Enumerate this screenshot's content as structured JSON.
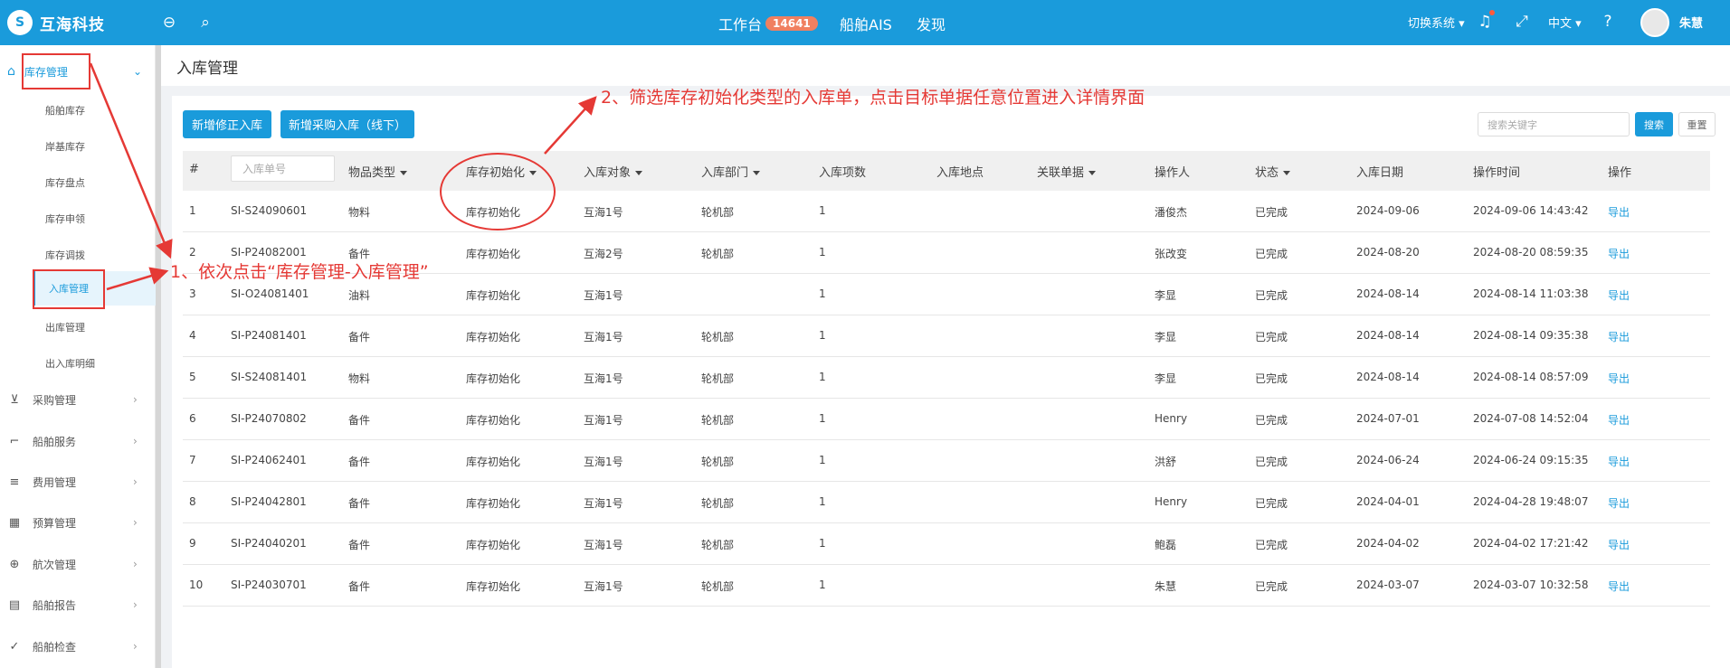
{
  "header": {
    "brand": "互海科技",
    "workbench_label": "工作台",
    "workbench_badge": "14641",
    "ais_label": "船舶AIS",
    "discover_label": "发现",
    "switch_system_label": "切换系统",
    "language_label": "中文",
    "user_name": "朱慧"
  },
  "sidebar": {
    "top_menu_label": "库存管理",
    "sub_items": [
      "船舶库存",
      "岸基库存",
      "库存盘点",
      "库存申领",
      "库存调拨",
      "入库管理",
      "出库管理",
      "出入库明细"
    ],
    "groups": [
      {
        "label": "采购管理",
        "icon": "cart-icon"
      },
      {
        "label": "船舶服务",
        "icon": "paint-roller-icon"
      },
      {
        "label": "费用管理",
        "icon": "database-icon"
      },
      {
        "label": "预算管理",
        "icon": "calculator-icon"
      },
      {
        "label": "航次管理",
        "icon": "globe-icon"
      },
      {
        "label": "船舶报告",
        "icon": "calendar-icon"
      },
      {
        "label": "船舶检查",
        "icon": "check-circle-icon"
      }
    ]
  },
  "page": {
    "title": "入库管理",
    "btn_add_correction": "新增修正入库",
    "btn_add_purchase": "新增采购入库（线下）",
    "search_placeholder": "搜索关键字",
    "btn_search": "搜索",
    "btn_reset": "重置"
  },
  "table": {
    "headers": {
      "index": "#",
      "order_placeholder": "入库单号",
      "item_type": "物品类型",
      "init": "库存初始化",
      "target": "入库对象",
      "dept": "入库部门",
      "count": "入库项数",
      "location": "入库地点",
      "related": "关联单据",
      "operator": "操作人",
      "status": "状态",
      "date": "入库日期",
      "op_time": "操作时间",
      "action": "操作"
    },
    "rows": [
      {
        "idx": "1",
        "no": "SI-S24090601",
        "type": "物料",
        "init": "库存初始化",
        "target": "互海1号",
        "dept": "轮机部",
        "count": "1",
        "operator": "潘俊杰",
        "status": "已完成",
        "date": "2024-09-06",
        "time": "2024-09-06 14:43:42",
        "action": "导出"
      },
      {
        "idx": "2",
        "no": "SI-P24082001",
        "type": "备件",
        "init": "库存初始化",
        "target": "互海2号",
        "dept": "轮机部",
        "count": "1",
        "operator": "张改变",
        "status": "已完成",
        "date": "2024-08-20",
        "time": "2024-08-20 08:59:35",
        "action": "导出"
      },
      {
        "idx": "3",
        "no": "SI-O24081401",
        "type": "油料",
        "init": "库存初始化",
        "target": "互海1号",
        "dept": "",
        "count": "1",
        "operator": "李显",
        "status": "已完成",
        "date": "2024-08-14",
        "time": "2024-08-14 11:03:38",
        "action": "导出"
      },
      {
        "idx": "4",
        "no": "SI-P24081401",
        "type": "备件",
        "init": "库存初始化",
        "target": "互海1号",
        "dept": "轮机部",
        "count": "1",
        "operator": "李显",
        "status": "已完成",
        "date": "2024-08-14",
        "time": "2024-08-14 09:35:38",
        "action": "导出"
      },
      {
        "idx": "5",
        "no": "SI-S24081401",
        "type": "物料",
        "init": "库存初始化",
        "target": "互海1号",
        "dept": "轮机部",
        "count": "1",
        "operator": "李显",
        "status": "已完成",
        "date": "2024-08-14",
        "time": "2024-08-14 08:57:09",
        "action": "导出"
      },
      {
        "idx": "6",
        "no": "SI-P24070802",
        "type": "备件",
        "init": "库存初始化",
        "target": "互海1号",
        "dept": "轮机部",
        "count": "1",
        "operator": "Henry",
        "status": "已完成",
        "date": "2024-07-01",
        "time": "2024-07-08 14:52:04",
        "action": "导出"
      },
      {
        "idx": "7",
        "no": "SI-P24062401",
        "type": "备件",
        "init": "库存初始化",
        "target": "互海1号",
        "dept": "轮机部",
        "count": "1",
        "operator": "洪舒",
        "status": "已完成",
        "date": "2024-06-24",
        "time": "2024-06-24 09:15:35",
        "action": "导出"
      },
      {
        "idx": "8",
        "no": "SI-P24042801",
        "type": "备件",
        "init": "库存初始化",
        "target": "互海1号",
        "dept": "轮机部",
        "count": "1",
        "operator": "Henry",
        "status": "已完成",
        "date": "2024-04-01",
        "time": "2024-04-28 19:48:07",
        "action": "导出"
      },
      {
        "idx": "9",
        "no": "SI-P24040201",
        "type": "备件",
        "init": "库存初始化",
        "target": "互海1号",
        "dept": "轮机部",
        "count": "1",
        "operator": "鲍磊",
        "status": "已完成",
        "date": "2024-04-02",
        "time": "2024-04-02 17:21:42",
        "action": "导出"
      },
      {
        "idx": "10",
        "no": "SI-P24030701",
        "type": "备件",
        "init": "库存初始化",
        "target": "互海1号",
        "dept": "轮机部",
        "count": "1",
        "operator": "朱慧",
        "status": "已完成",
        "date": "2024-03-07",
        "time": "2024-03-07 10:32:58",
        "action": "导出"
      }
    ]
  },
  "annotations": {
    "step1": "1、依次点击“库存管理-入库管理”",
    "step2": "2、筛选库存初始化类型的入库单，点击目标单据任意位置进入详情界面",
    "color": "#e53935"
  },
  "colors": {
    "primary": "#1a9bdb",
    "badge": "#f08060"
  }
}
